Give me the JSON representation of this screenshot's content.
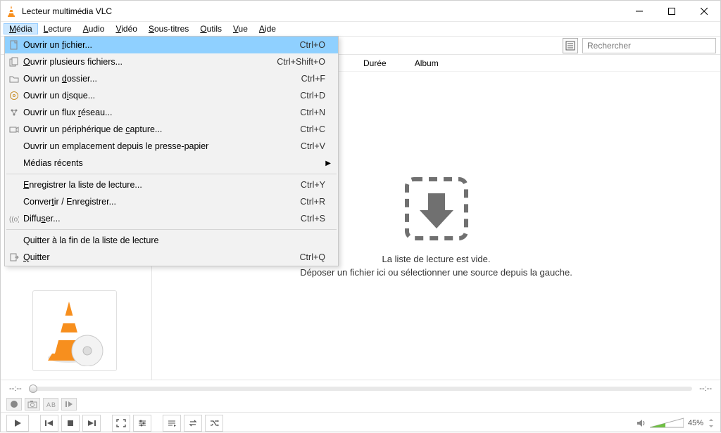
{
  "window": {
    "title": "Lecteur multimédia VLC"
  },
  "menubar": [
    {
      "label": "Média",
      "ul": "M",
      "rest": "édia",
      "active": true
    },
    {
      "label": "Lecture",
      "ul": "L",
      "rest": "ecture"
    },
    {
      "label": "Audio",
      "ul": "A",
      "rest": "udio"
    },
    {
      "label": "Vidéo",
      "ul": "V",
      "rest": "idéo"
    },
    {
      "label": "Sous-titres",
      "ul": "S",
      "rest": "ous-titres"
    },
    {
      "label": "Outils",
      "ul": "O",
      "rest": "utils"
    },
    {
      "label": "Vue",
      "ul": "V",
      "rest": "ue"
    },
    {
      "label": "Aide",
      "ul": "A",
      "rest": "ide"
    }
  ],
  "dropdown": {
    "items": [
      {
        "icon": "file-icon",
        "pre": "Ouvrir un ",
        "ul": "f",
        "post": "ichier...",
        "shortcut": "Ctrl+O",
        "highlighted": true
      },
      {
        "icon": "files-icon",
        "pre": "",
        "ul": "O",
        "post": "uvrir plusieurs fichiers...",
        "shortcut": "Ctrl+Shift+O"
      },
      {
        "icon": "folder-icon",
        "pre": "Ouvrir un ",
        "ul": "d",
        "post": "ossier...",
        "shortcut": "Ctrl+F"
      },
      {
        "icon": "disc-icon",
        "pre": "Ouvrir un d",
        "ul": "i",
        "post": "sque...",
        "shortcut": "Ctrl+D"
      },
      {
        "icon": "network-icon",
        "pre": "Ouvrir un flux ",
        "ul": "r",
        "post": "éseau...",
        "shortcut": "Ctrl+N"
      },
      {
        "icon": "capture-icon",
        "pre": "Ouvrir un périphérique de ",
        "ul": "c",
        "post": "apture...",
        "shortcut": "Ctrl+C"
      },
      {
        "icon": "",
        "pre": "Ouvrir un emplacement depuis le presse-papier",
        "ul": "",
        "post": "",
        "shortcut": "Ctrl+V"
      },
      {
        "icon": "",
        "pre": "Médias récents",
        "ul": "",
        "post": "",
        "shortcut": "",
        "submenu": true
      },
      {
        "sep": true
      },
      {
        "icon": "",
        "pre": "",
        "ul": "E",
        "post": "nregistrer la liste de lecture...",
        "shortcut": "Ctrl+Y"
      },
      {
        "icon": "",
        "pre": "Conver",
        "ul": "t",
        "post": "ir / Enregistrer...",
        "shortcut": "Ctrl+R"
      },
      {
        "icon": "stream-icon",
        "pre": "Diffu",
        "ul": "s",
        "post": "er...",
        "shortcut": "Ctrl+S"
      },
      {
        "sep": true
      },
      {
        "icon": "",
        "pre": "Quitter à la fin de la liste de lecture",
        "ul": "",
        "post": "",
        "shortcut": ""
      },
      {
        "icon": "quit-icon",
        "pre": "",
        "ul": "Q",
        "post": "uitter",
        "shortcut": "Ctrl+Q"
      }
    ]
  },
  "search": {
    "placeholder": "Rechercher"
  },
  "columns": {
    "duration": "Durée",
    "album": "Album"
  },
  "empty": {
    "line1": "La liste de lecture est vide.",
    "line2": "Déposer un fichier ici ou sélectionner une source depuis la gauche."
  },
  "seek": {
    "left": "--:--",
    "right": "--:--"
  },
  "volume": {
    "label": "45%"
  }
}
